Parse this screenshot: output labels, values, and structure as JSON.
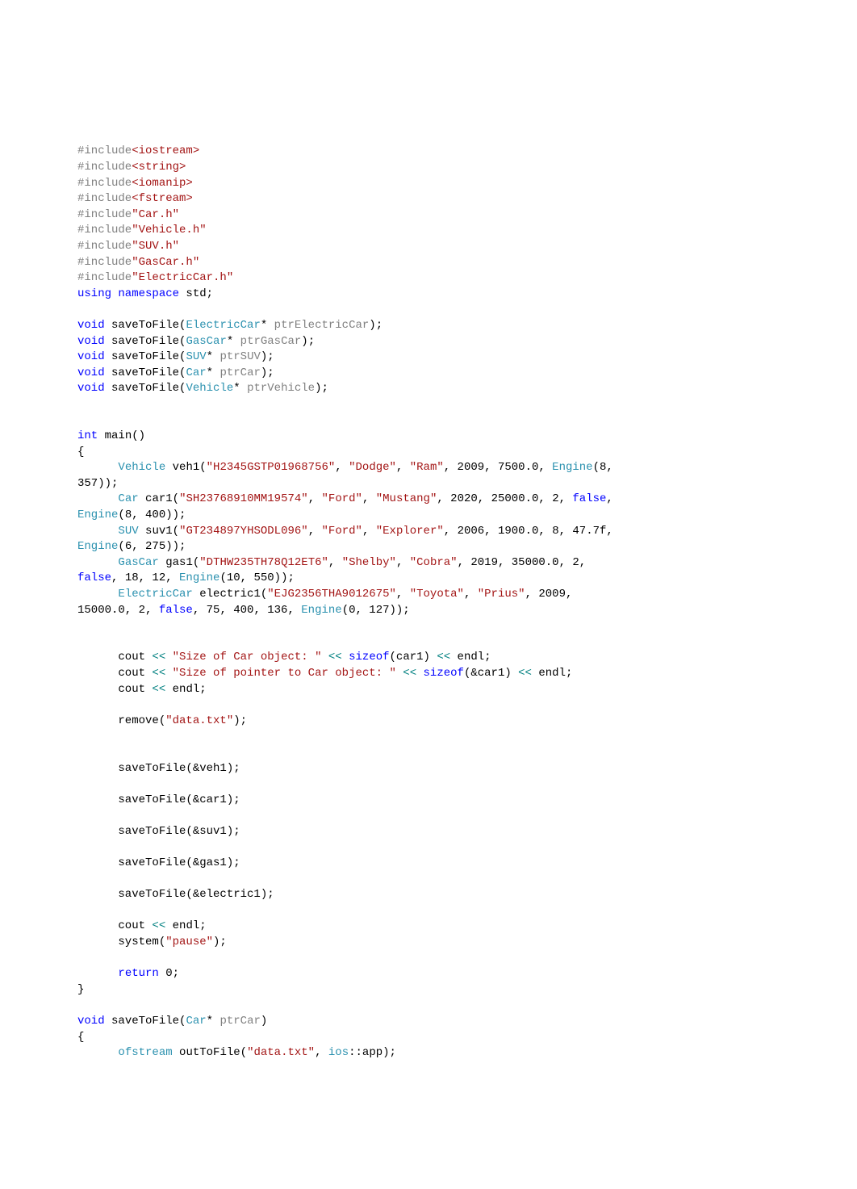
{
  "lines": [
    [
      {
        "t": "#include",
        "c": "c-include"
      },
      {
        "t": "<iostream>",
        "c": "c-incheader"
      }
    ],
    [
      {
        "t": "#include",
        "c": "c-include"
      },
      {
        "t": "<string>",
        "c": "c-incheader"
      }
    ],
    [
      {
        "t": "#include",
        "c": "c-include"
      },
      {
        "t": "<iomanip>",
        "c": "c-incheader"
      }
    ],
    [
      {
        "t": "#include",
        "c": "c-include"
      },
      {
        "t": "<fstream>",
        "c": "c-incheader"
      }
    ],
    [
      {
        "t": "#include",
        "c": "c-include"
      },
      {
        "t": "\"Car.h\"",
        "c": "c-incheader"
      }
    ],
    [
      {
        "t": "#include",
        "c": "c-include"
      },
      {
        "t": "\"Vehicle.h\"",
        "c": "c-incheader"
      }
    ],
    [
      {
        "t": "#include",
        "c": "c-include"
      },
      {
        "t": "\"SUV.h\"",
        "c": "c-incheader"
      }
    ],
    [
      {
        "t": "#include",
        "c": "c-include"
      },
      {
        "t": "\"GasCar.h\"",
        "c": "c-incheader"
      }
    ],
    [
      {
        "t": "#include",
        "c": "c-include"
      },
      {
        "t": "\"ElectricCar.h\"",
        "c": "c-incheader"
      }
    ],
    [
      {
        "t": "using namespace",
        "c": "c-keyword"
      },
      {
        "t": " std;",
        "c": ""
      }
    ],
    [
      {
        "t": " ",
        "c": ""
      }
    ],
    [
      {
        "t": "void",
        "c": "c-keyword"
      },
      {
        "t": " saveToFile(",
        "c": ""
      },
      {
        "t": "ElectricCar",
        "c": "c-type"
      },
      {
        "t": "* ",
        "c": ""
      },
      {
        "t": "ptrElectricCar",
        "c": "c-param"
      },
      {
        "t": ");",
        "c": ""
      }
    ],
    [
      {
        "t": "void",
        "c": "c-keyword"
      },
      {
        "t": " saveToFile(",
        "c": ""
      },
      {
        "t": "GasCar",
        "c": "c-type"
      },
      {
        "t": "* ",
        "c": ""
      },
      {
        "t": "ptrGasCar",
        "c": "c-param"
      },
      {
        "t": ");",
        "c": ""
      }
    ],
    [
      {
        "t": "void",
        "c": "c-keyword"
      },
      {
        "t": " saveToFile(",
        "c": ""
      },
      {
        "t": "SUV",
        "c": "c-type"
      },
      {
        "t": "* ",
        "c": ""
      },
      {
        "t": "ptrSUV",
        "c": "c-param"
      },
      {
        "t": ");",
        "c": ""
      }
    ],
    [
      {
        "t": "void",
        "c": "c-keyword"
      },
      {
        "t": " saveToFile(",
        "c": ""
      },
      {
        "t": "Car",
        "c": "c-type"
      },
      {
        "t": "* ",
        "c": ""
      },
      {
        "t": "ptrCar",
        "c": "c-param"
      },
      {
        "t": ");",
        "c": ""
      }
    ],
    [
      {
        "t": "void",
        "c": "c-keyword"
      },
      {
        "t": " saveToFile(",
        "c": ""
      },
      {
        "t": "Vehicle",
        "c": "c-type"
      },
      {
        "t": "* ",
        "c": ""
      },
      {
        "t": "ptrVehicle",
        "c": "c-param"
      },
      {
        "t": ");",
        "c": ""
      }
    ],
    [
      {
        "t": " ",
        "c": ""
      }
    ],
    [
      {
        "t": " ",
        "c": ""
      }
    ],
    [
      {
        "t": "int",
        "c": "c-keyword"
      },
      {
        "t": " main()",
        "c": ""
      }
    ],
    [
      {
        "t": "{",
        "c": ""
      }
    ],
    [
      {
        "t": "      ",
        "c": ""
      },
      {
        "t": "Vehicle",
        "c": "c-type"
      },
      {
        "t": " veh1(",
        "c": ""
      },
      {
        "t": "\"H2345GSTP01968756\"",
        "c": "c-string"
      },
      {
        "t": ", ",
        "c": ""
      },
      {
        "t": "\"Dodge\"",
        "c": "c-string"
      },
      {
        "t": ", ",
        "c": ""
      },
      {
        "t": "\"Ram\"",
        "c": "c-string"
      },
      {
        "t": ", 2009, 7500.0, ",
        "c": ""
      },
      {
        "t": "Engine",
        "c": "c-type"
      },
      {
        "t": "(8, ",
        "c": ""
      }
    ],
    [
      {
        "t": "357));",
        "c": ""
      }
    ],
    [
      {
        "t": "      ",
        "c": ""
      },
      {
        "t": "Car",
        "c": "c-type"
      },
      {
        "t": " car1(",
        "c": ""
      },
      {
        "t": "\"SH23768910MM19574\"",
        "c": "c-string"
      },
      {
        "t": ", ",
        "c": ""
      },
      {
        "t": "\"Ford\"",
        "c": "c-string"
      },
      {
        "t": ", ",
        "c": ""
      },
      {
        "t": "\"Mustang\"",
        "c": "c-string"
      },
      {
        "t": ", 2020, 25000.0, 2, ",
        "c": ""
      },
      {
        "t": "false",
        "c": "c-bool"
      },
      {
        "t": ", ",
        "c": ""
      }
    ],
    [
      {
        "t": "Engine",
        "c": "c-type"
      },
      {
        "t": "(8, 400));",
        "c": ""
      }
    ],
    [
      {
        "t": "      ",
        "c": ""
      },
      {
        "t": "SUV",
        "c": "c-type"
      },
      {
        "t": " suv1(",
        "c": ""
      },
      {
        "t": "\"GT234897YHSODL096\"",
        "c": "c-string"
      },
      {
        "t": ", ",
        "c": ""
      },
      {
        "t": "\"Ford\"",
        "c": "c-string"
      },
      {
        "t": ", ",
        "c": ""
      },
      {
        "t": "\"Explorer\"",
        "c": "c-string"
      },
      {
        "t": ", 2006, 1900.0, 8, 47.7f, ",
        "c": ""
      }
    ],
    [
      {
        "t": "Engine",
        "c": "c-type"
      },
      {
        "t": "(6, 275));",
        "c": ""
      }
    ],
    [
      {
        "t": "      ",
        "c": ""
      },
      {
        "t": "GasCar",
        "c": "c-type"
      },
      {
        "t": " gas1(",
        "c": ""
      },
      {
        "t": "\"DTHW235TH78Q12ET6\"",
        "c": "c-string"
      },
      {
        "t": ", ",
        "c": ""
      },
      {
        "t": "\"Shelby\"",
        "c": "c-string"
      },
      {
        "t": ", ",
        "c": ""
      },
      {
        "t": "\"Cobra\"",
        "c": "c-string"
      },
      {
        "t": ", 2019, 35000.0, 2, ",
        "c": ""
      }
    ],
    [
      {
        "t": "false",
        "c": "c-bool"
      },
      {
        "t": ", 18, 12, ",
        "c": ""
      },
      {
        "t": "Engine",
        "c": "c-type"
      },
      {
        "t": "(10, 550));",
        "c": ""
      }
    ],
    [
      {
        "t": "      ",
        "c": ""
      },
      {
        "t": "ElectricCar",
        "c": "c-type"
      },
      {
        "t": " electric1(",
        "c": ""
      },
      {
        "t": "\"EJG2356THA9012675\"",
        "c": "c-string"
      },
      {
        "t": ", ",
        "c": ""
      },
      {
        "t": "\"Toyota\"",
        "c": "c-string"
      },
      {
        "t": ", ",
        "c": ""
      },
      {
        "t": "\"Prius\"",
        "c": "c-string"
      },
      {
        "t": ", 2009, ",
        "c": ""
      }
    ],
    [
      {
        "t": "15000.0, 2, ",
        "c": ""
      },
      {
        "t": "false",
        "c": "c-bool"
      },
      {
        "t": ", 75, 400, 136, ",
        "c": ""
      },
      {
        "t": "Engine",
        "c": "c-type"
      },
      {
        "t": "(0, 127));",
        "c": ""
      }
    ],
    [
      {
        "t": " ",
        "c": ""
      }
    ],
    [
      {
        "t": " ",
        "c": ""
      }
    ],
    [
      {
        "t": "      cout ",
        "c": ""
      },
      {
        "t": "<<",
        "c": "c-op"
      },
      {
        "t": " ",
        "c": ""
      },
      {
        "t": "\"Size of Car object: \"",
        "c": "c-string"
      },
      {
        "t": " ",
        "c": ""
      },
      {
        "t": "<<",
        "c": "c-op"
      },
      {
        "t": " ",
        "c": ""
      },
      {
        "t": "sizeof",
        "c": "c-keyword"
      },
      {
        "t": "(car1) ",
        "c": ""
      },
      {
        "t": "<<",
        "c": "c-op"
      },
      {
        "t": " endl;",
        "c": ""
      }
    ],
    [
      {
        "t": "      cout ",
        "c": ""
      },
      {
        "t": "<<",
        "c": "c-op"
      },
      {
        "t": " ",
        "c": ""
      },
      {
        "t": "\"Size of pointer to Car object: \"",
        "c": "c-string"
      },
      {
        "t": " ",
        "c": ""
      },
      {
        "t": "<<",
        "c": "c-op"
      },
      {
        "t": " ",
        "c": ""
      },
      {
        "t": "sizeof",
        "c": "c-keyword"
      },
      {
        "t": "(&car1) ",
        "c": ""
      },
      {
        "t": "<<",
        "c": "c-op"
      },
      {
        "t": " endl;",
        "c": ""
      }
    ],
    [
      {
        "t": "      cout ",
        "c": ""
      },
      {
        "t": "<<",
        "c": "c-op"
      },
      {
        "t": " endl;",
        "c": ""
      }
    ],
    [
      {
        "t": " ",
        "c": ""
      }
    ],
    [
      {
        "t": "      remove(",
        "c": ""
      },
      {
        "t": "\"data.txt\"",
        "c": "c-string"
      },
      {
        "t": ");",
        "c": ""
      }
    ],
    [
      {
        "t": " ",
        "c": ""
      }
    ],
    [
      {
        "t": " ",
        "c": ""
      }
    ],
    [
      {
        "t": "      saveToFile(&veh1);",
        "c": ""
      }
    ],
    [
      {
        "t": " ",
        "c": ""
      }
    ],
    [
      {
        "t": "      saveToFile(&car1);",
        "c": ""
      }
    ],
    [
      {
        "t": " ",
        "c": ""
      }
    ],
    [
      {
        "t": "      saveToFile(&suv1);",
        "c": ""
      }
    ],
    [
      {
        "t": " ",
        "c": ""
      }
    ],
    [
      {
        "t": "      saveToFile(&gas1);",
        "c": ""
      }
    ],
    [
      {
        "t": " ",
        "c": ""
      }
    ],
    [
      {
        "t": "      saveToFile(&electric1);",
        "c": ""
      }
    ],
    [
      {
        "t": " ",
        "c": ""
      }
    ],
    [
      {
        "t": "      cout ",
        "c": ""
      },
      {
        "t": "<<",
        "c": "c-op"
      },
      {
        "t": " endl;",
        "c": ""
      }
    ],
    [
      {
        "t": "      system(",
        "c": ""
      },
      {
        "t": "\"pause\"",
        "c": "c-string"
      },
      {
        "t": ");",
        "c": ""
      }
    ],
    [
      {
        "t": " ",
        "c": ""
      }
    ],
    [
      {
        "t": "      ",
        "c": ""
      },
      {
        "t": "return",
        "c": "c-keyword"
      },
      {
        "t": " 0;",
        "c": ""
      }
    ],
    [
      {
        "t": "}",
        "c": ""
      }
    ],
    [
      {
        "t": " ",
        "c": ""
      }
    ],
    [
      {
        "t": "void",
        "c": "c-keyword"
      },
      {
        "t": " saveToFile(",
        "c": ""
      },
      {
        "t": "Car",
        "c": "c-type"
      },
      {
        "t": "* ",
        "c": ""
      },
      {
        "t": "ptrCar",
        "c": "c-param"
      },
      {
        "t": ")",
        "c": ""
      }
    ],
    [
      {
        "t": "{",
        "c": ""
      }
    ],
    [
      {
        "t": "      ",
        "c": ""
      },
      {
        "t": "ofstream",
        "c": "c-type"
      },
      {
        "t": " outToFile(",
        "c": ""
      },
      {
        "t": "\"data.txt\"",
        "c": "c-string"
      },
      {
        "t": ", ",
        "c": ""
      },
      {
        "t": "ios",
        "c": "c-type"
      },
      {
        "t": "::app);",
        "c": ""
      }
    ]
  ]
}
